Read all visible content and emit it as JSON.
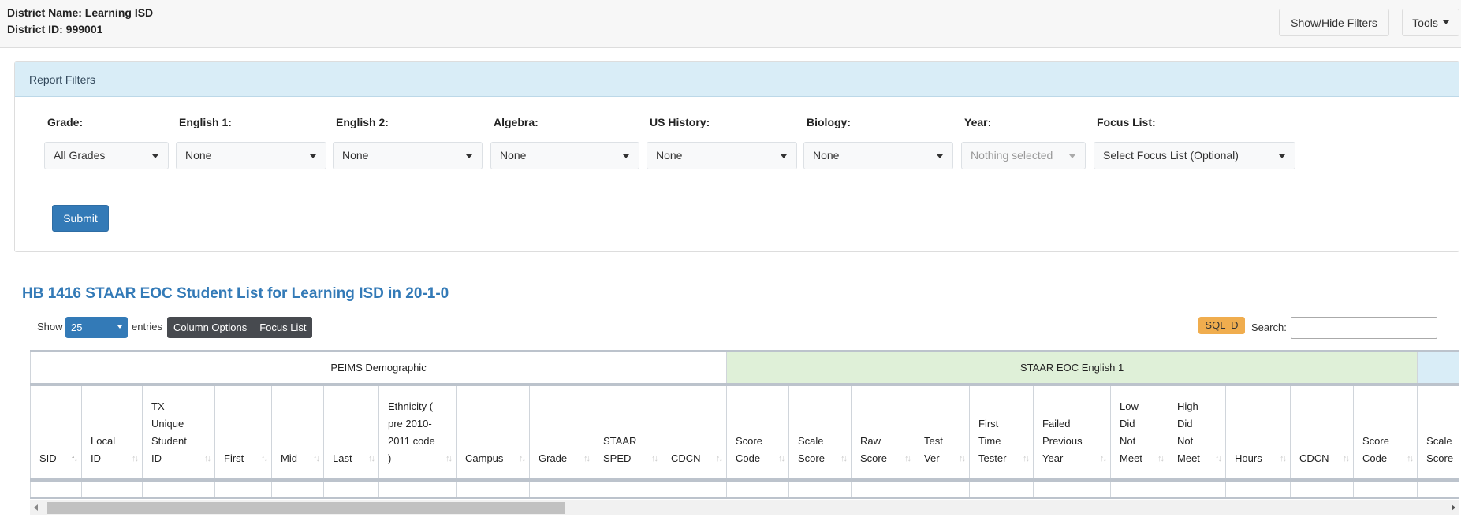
{
  "header": {
    "district_name": "District Name: Learning ISD",
    "district_id": "District ID: 999001",
    "show_hide_filters": "Show/Hide Filters",
    "tools": "Tools"
  },
  "filters": {
    "title": "Report Filters",
    "items": [
      {
        "label": "Grade:",
        "value": "All Grades"
      },
      {
        "label": "English 1:",
        "value": "None"
      },
      {
        "label": "English 2:",
        "value": "None"
      },
      {
        "label": "Algebra:",
        "value": "None"
      },
      {
        "label": "US History:",
        "value": "None"
      },
      {
        "label": "Biology:",
        "value": "None"
      },
      {
        "label": "Year:",
        "value": "Nothing selected",
        "disabled": true
      },
      {
        "label": "Focus List:",
        "value": "Select Focus List (Optional)"
      }
    ],
    "submit": "Submit"
  },
  "report": {
    "title": "HB 1416 STAAR EOC Student List for Learning ISD in 20-1-0",
    "show": "Show",
    "entries_value": "25",
    "entries": "entries",
    "column_options": "Column Options",
    "focus_list": "Focus List",
    "sql_d": "SQL  D",
    "search_label": "Search:",
    "search_value": ""
  },
  "table": {
    "groups": [
      {
        "label": "PEIMS Demographic",
        "span": 11,
        "color": "#ffffff"
      },
      {
        "label": "STAAR EOC English 1",
        "span": 11,
        "color": "#dff0d8"
      },
      {
        "label": "",
        "span": 3,
        "color": "#d9edf7"
      }
    ],
    "columns": [
      "SID",
      "Local ID",
      "TX Unique Student ID",
      "First",
      "Mid",
      "Last",
      "Ethnicity ( pre 2010- 2011 code )",
      "Campus",
      "Grade",
      "STAAR SPED",
      "CDCN",
      "Score Code",
      "Scale Score",
      "Raw Score",
      "Test Ver",
      "First Time Tester",
      "Failed Previous Year",
      "Low Did Not Meet",
      "High Did Not Meet",
      "Hours",
      "CDCN",
      "Score Code",
      "Scale Score"
    ],
    "sorted_column": "SID",
    "sort_direction": "ascending"
  }
}
